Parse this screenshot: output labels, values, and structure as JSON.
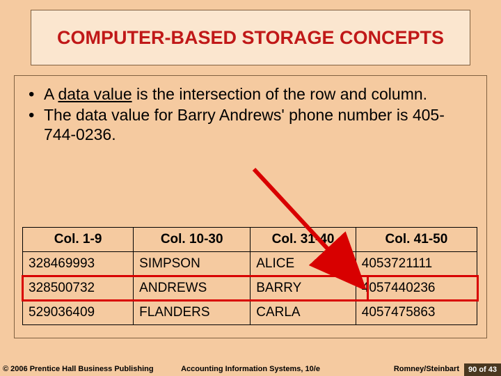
{
  "title": "COMPUTER-BASED STORAGE CONCEPTS",
  "bullets": [
    {
      "pre": "A ",
      "u": "data value",
      "post": " is the intersection of the row and column."
    },
    {
      "pre": "The data value for Barry Andrews' phone number is 405-744-0236.",
      "u": "",
      "post": ""
    }
  ],
  "table": {
    "headers": [
      "Col. 1-9",
      "Col. 10-30",
      "Col. 31-40",
      "Col. 41-50"
    ],
    "rows": [
      [
        "328469993",
        "SIMPSON",
        "ALICE",
        "4053721111"
      ],
      [
        "328500732",
        "ANDREWS",
        "BARRY",
        "4057440236"
      ],
      [
        "529036409",
        "FLANDERS",
        "CARLA",
        "4057475863"
      ]
    ]
  },
  "footer": {
    "copyright": "© 2006 Prentice Hall Business Publishing",
    "center": "Accounting Information Systems, 10/e",
    "authors": "Romney/Steinbart",
    "page": "90 of 43"
  }
}
